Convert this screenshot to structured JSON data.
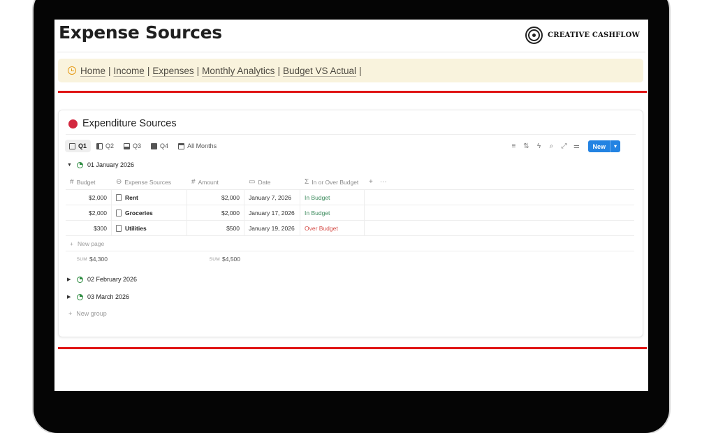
{
  "page": {
    "title": "Expense Sources",
    "brand": "CREATIVE CASHFLOW"
  },
  "nav": {
    "links": [
      "Home",
      "Income",
      "Expenses",
      "Monthly Analytics",
      "Budget VS Actual"
    ],
    "separator": "|"
  },
  "database": {
    "title": "Expenditure Sources",
    "views": [
      "Q1",
      "Q2",
      "Q3",
      "Q4",
      "All Months"
    ],
    "active_view": "Q1",
    "new_label": "New",
    "columns": [
      "Budget",
      "Expense Sources",
      "Amount",
      "Date",
      "In or Over Budget"
    ],
    "groups": [
      {
        "label": "01 January 2026",
        "expanded": true,
        "rows": [
          {
            "budget": "$2,000",
            "source": "Rent",
            "amount": "$2,000",
            "date": "January 7, 2026",
            "status": "In Budget"
          },
          {
            "budget": "$2,000",
            "source": "Groceries",
            "amount": "$2,000",
            "date": "January 17, 2026",
            "status": "In Budget"
          },
          {
            "budget": "$300",
            "source": "Utilities",
            "amount": "$500",
            "date": "January 19, 2026",
            "status": "Over Budget"
          }
        ],
        "new_page_label": "New page",
        "sum_label": "SUM",
        "sum_budget": "$4,300",
        "sum_amount": "$4,500"
      },
      {
        "label": "02 February 2026",
        "expanded": false
      },
      {
        "label": "03 March 2026",
        "expanded": false
      }
    ],
    "new_group_label": "New group"
  },
  "colors": {
    "accent": "#2383e2",
    "divider_red": "#e01414",
    "status_in": "#3b8a5c",
    "status_over": "#d44c47",
    "nav_bg": "#f9f3dd"
  }
}
